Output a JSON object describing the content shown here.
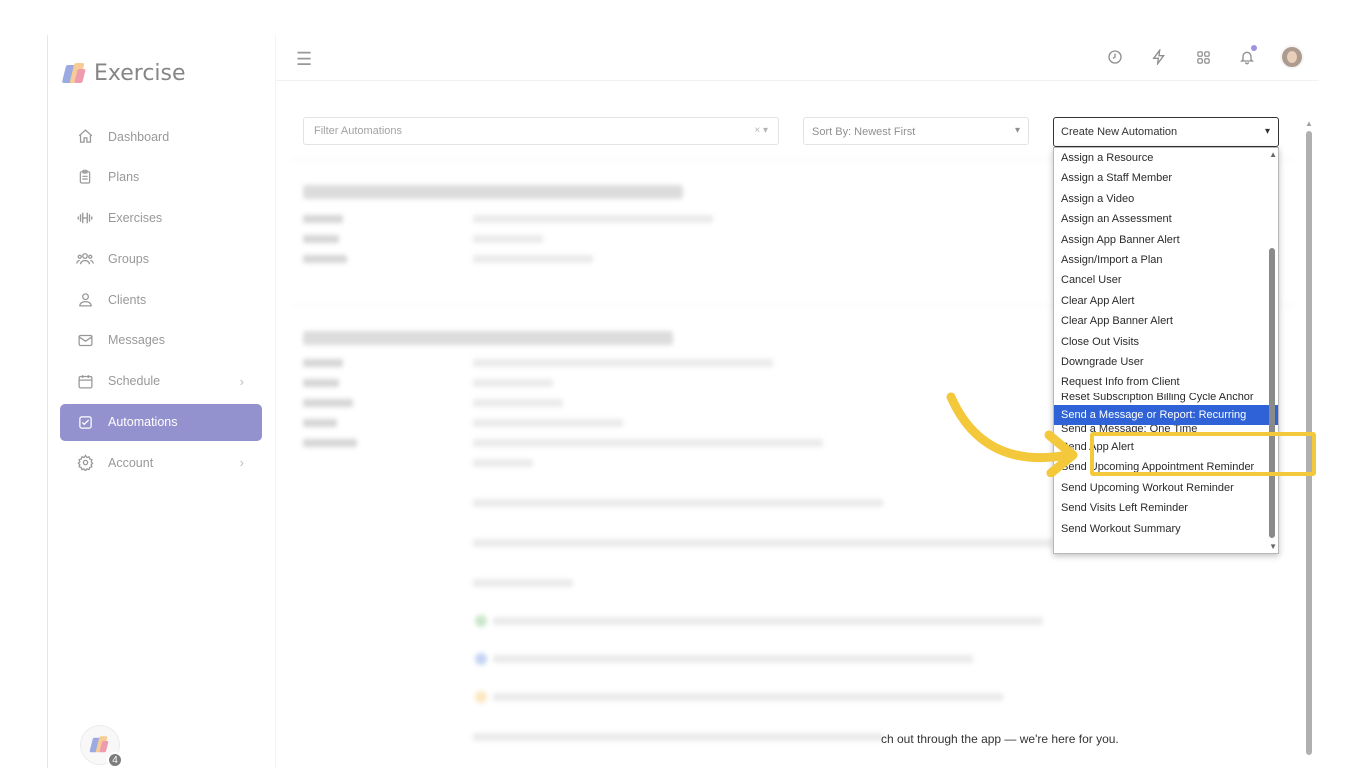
{
  "app": {
    "name": "Exercise"
  },
  "sidebar": {
    "items": [
      {
        "label": "Dashboard",
        "icon": "home-icon"
      },
      {
        "label": "Plans",
        "icon": "clipboard-icon"
      },
      {
        "label": "Exercises",
        "icon": "dumbbell-icon"
      },
      {
        "label": "Groups",
        "icon": "group-icon"
      },
      {
        "label": "Clients",
        "icon": "user-icon"
      },
      {
        "label": "Messages",
        "icon": "mail-icon"
      },
      {
        "label": "Schedule",
        "icon": "calendar-icon",
        "has_submenu": true
      },
      {
        "label": "Automations",
        "icon": "checkbox-icon",
        "active": true
      },
      {
        "label": "Account",
        "icon": "gear-icon",
        "has_submenu": true
      }
    ],
    "bottom_badge": "4"
  },
  "filters": {
    "filter_placeholder": "Filter Automations",
    "filter_controls": "× ▾",
    "sort_label": "Sort By: Newest First",
    "create_label": "Create New Automation"
  },
  "dropdown": {
    "items": [
      "Assign a Resource",
      "Assign a Staff Member",
      "Assign a Video",
      "Assign an Assessment",
      "Assign App Banner Alert",
      "Assign/Import a Plan",
      "Cancel User",
      "Clear App Alert",
      "Clear App Banner Alert",
      "Close Out Visits",
      "Downgrade User",
      "Request Info from Client",
      "Reset Subscription Billing Cycle Anchor",
      "Send a Message or Report: Recurring",
      "Send a Message: One Time",
      "Send App Alert",
      "Send Upcoming Appointment Reminder",
      "Send Upcoming Workout Reminder",
      "Send Visits Left Reminder",
      "Send Workout Summary"
    ],
    "selected_index": 13
  },
  "content": {
    "tail_text": "ch out through the app — we're here for you."
  },
  "colors": {
    "accent": "#3c37a8",
    "selected": "#2e62d6",
    "highlight": "#f3c83b"
  }
}
